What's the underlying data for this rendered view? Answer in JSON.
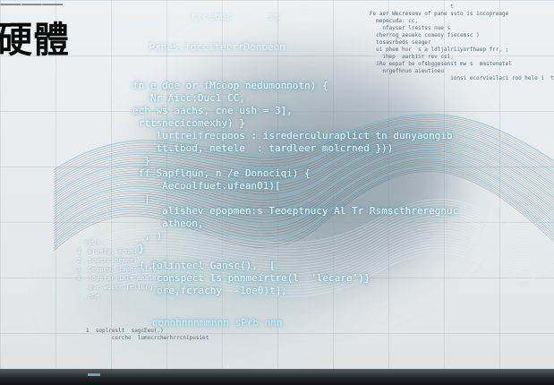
{
  "title": "硬體",
  "title_top": "⸺⸺⸺",
  "code_main": [
    "         ",
    "fn e doe or fMcoop nedumonnotn) {",
    "   Nr Aicc:Duc1 CC,",
    "",
    "ech ws aachs, cne ush = 3],",
    " rttsnecicomexhy) }",
    "    lurtreifrecpoos : isrederculuraplict tn dunyaongib",
    "    tt.tbod, netele  : tardleer molcrned }))",
    "  }",
    " ff Sapflqun, n /e Donociqi) {",
    "     Aecoolfuet.ufean01)[",
    "  |",
    "     alishev epopmen:s Teoeptnucy Al Tr Rsmscthreregnuc",
    "     atheon,",
    "  , )",
    " }"
  ],
  "code_lower": [
    "  ( folintecl Gansc(),  [",
    "     conspect ls pnnmeirtre(l  'lecare')}",
    "     ore,fcrachy  -1oe0)t];"
  ],
  "code_bottom": "      connhnnnmmnnn sPrb nnn",
  "code_side_left": [
    "  ",
    "  soua",
    "",
    "1  Eroels, mouel",
    "2  sovtrd bemer(",
    "3  Oeppeu, lapnsoulty",
    "4  topptarlinle dhalo",
    "   aur wostr fellurg",
    "   nue"
  ],
  "code_bottom_left": [
    "1  soplreslt  sagcEeu(.)",
    "",
    "        corcho  lumocrcherhrrcnipusiet"
  ],
  "code_right": [
    "                                 t",
    "        Fe aer Wecresumv of pane ssto is incopreage",
    "          mepecuda: cc,",
    "            nfayser lreitss nue s",
    "          cherrog_aeueko comeoy fiecemsc )",
    "          tosasrbeds seager",
    "          ui phem hor  s a ldljalriiyorfhaep frr, ;",
    "            ihep  aarbiir rev cs1,",
    "",
    "          iRe eepaf be ofsbggesenst mw s  mmstenetel",
    "            nrgefhnuo aieutioeu",
    "",
    "",
    "                                 ionsi ecorvieilaci roo hele i  t llatavsiehsr;"
  ],
  "code_top_center": "    Pxnes.fdccitecrrDonbeon",
  "code_top_faint": "        ricebos      ss"
}
